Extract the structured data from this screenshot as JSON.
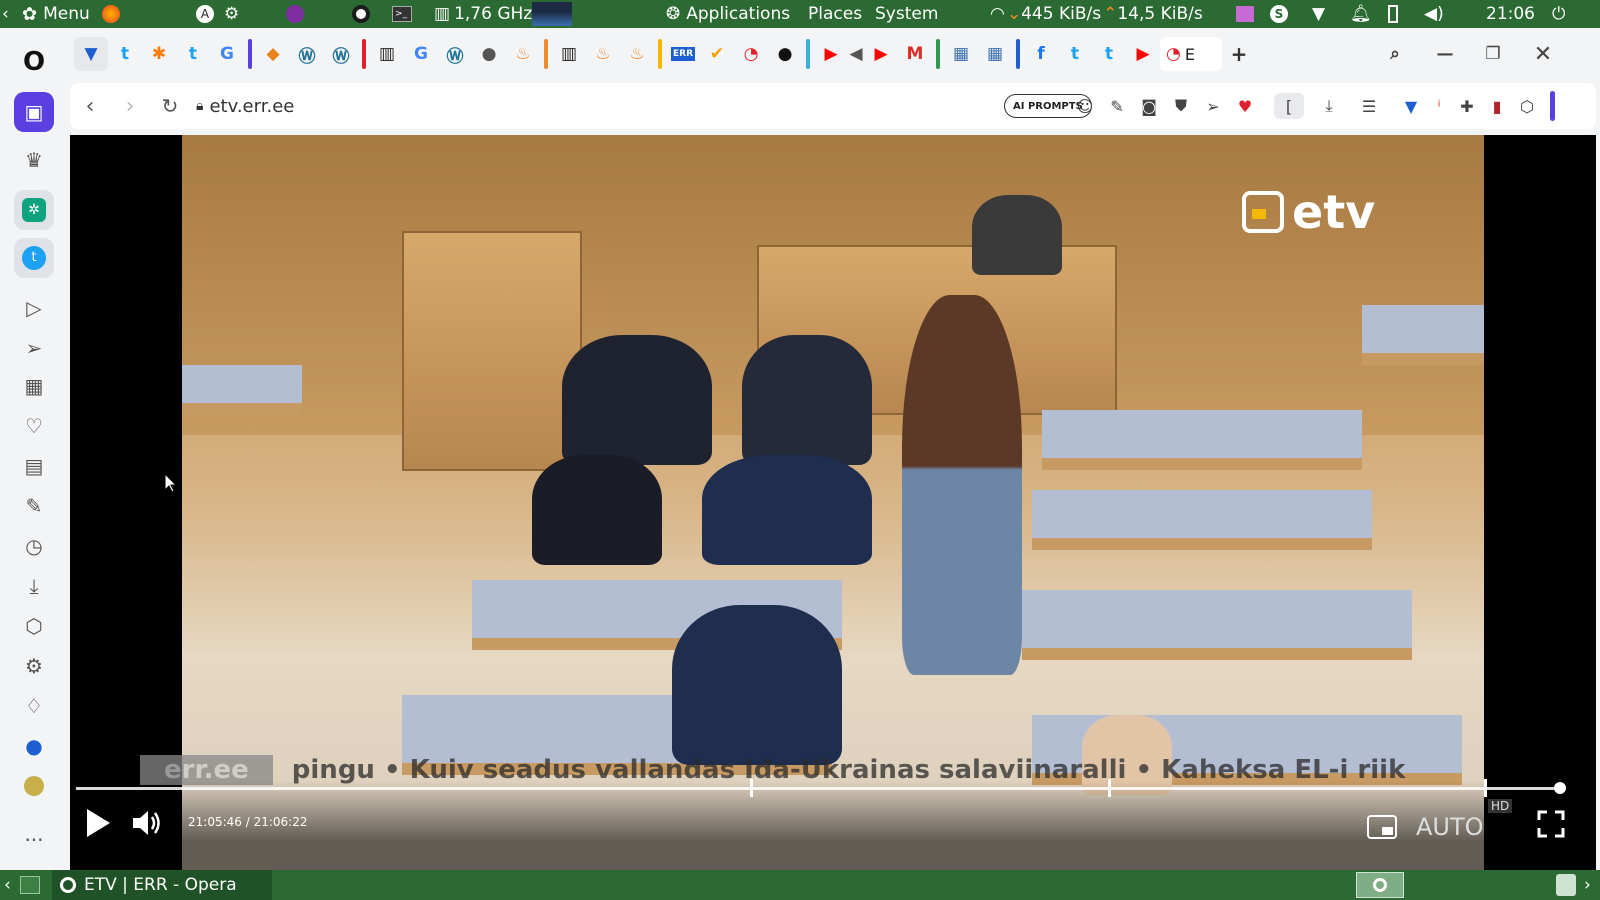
{
  "system_panel": {
    "menu_label": "Menu",
    "cpu_freq": "1,76 GHz",
    "apps_label": "Applications",
    "places_label": "Places",
    "system_label": "System",
    "net_down": "445 KiB/s",
    "net_up": "14,5 KiB/s",
    "clock": "21:06"
  },
  "browser": {
    "url": "etv.err.ee",
    "ai_prompts_label": "AI PROMPTS",
    "active_tab_label": "E",
    "colors": {
      "brand": "#2b6a32",
      "opera_red": "#e0202c",
      "sidebar_active": "#5b3fe0"
    }
  },
  "video": {
    "channel_logo": "etv",
    "ticker": {
      "tag": "err.ee",
      "text": "pingu  •  Kuiv seadus vallandas Ida-Ukrainas salaviinaralli  •  Kaheksa EL-i riik"
    },
    "time_display": "21:05:46 / 21:06:22",
    "quality_label": "AUTO",
    "hd_badge": "HD",
    "progress": 1.0
  },
  "taskbar": {
    "window_title": "ETV | ERR - Opera"
  }
}
